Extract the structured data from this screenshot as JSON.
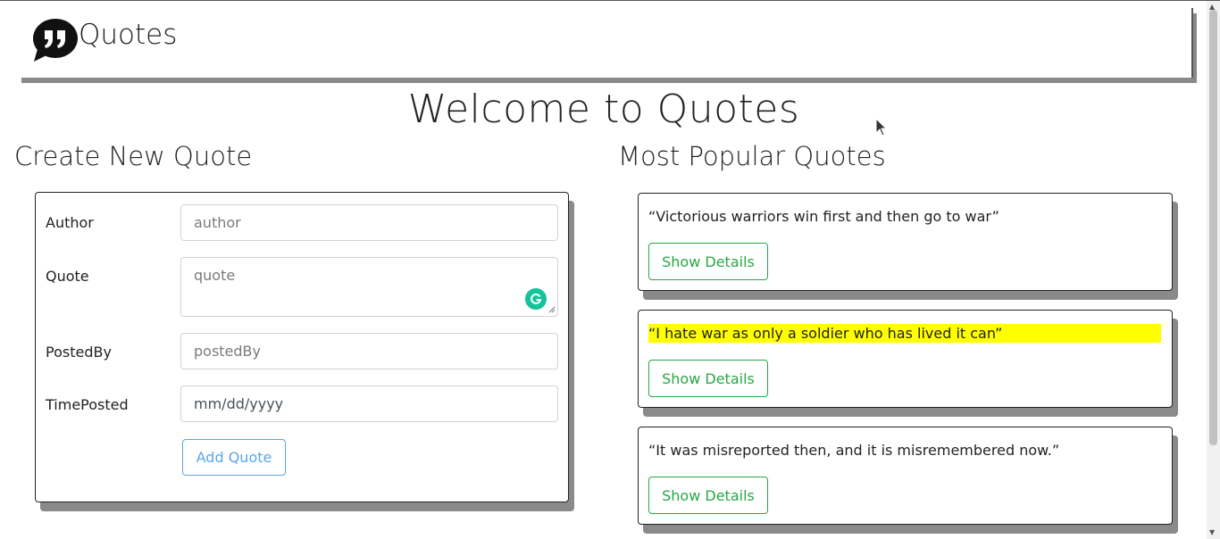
{
  "header": {
    "brand": "Quotes",
    "logo_icon": "quote-bubble-icon"
  },
  "welcome": "Welcome to Quotes",
  "create": {
    "heading": "Create New Quote",
    "fields": [
      {
        "label": "Author",
        "placeholder": "author"
      },
      {
        "label": "Quote",
        "placeholder": "quote"
      },
      {
        "label": "PostedBy",
        "placeholder": "postedBy"
      },
      {
        "label": "TimePosted",
        "placeholder": "mm/dd/yyyy"
      }
    ],
    "submit_label": "Add Quote"
  },
  "popular": {
    "heading": "Most Popular Quotes",
    "quotes": [
      {
        "text": "“Victorious warriors win first and then go to war”",
        "button": "Show Details"
      },
      {
        "text": "“I hate war as only a soldier who has lived it can”",
        "button": "Show Details",
        "highlighted": true
      },
      {
        "text": "“It was misreported then, and it is misremembered now.”",
        "button": "Show Details"
      }
    ]
  },
  "colors": {
    "primary": "#5aa6e8",
    "success": "#28a745",
    "highlight": "#ffff00",
    "grammarly": "#15c39a"
  }
}
